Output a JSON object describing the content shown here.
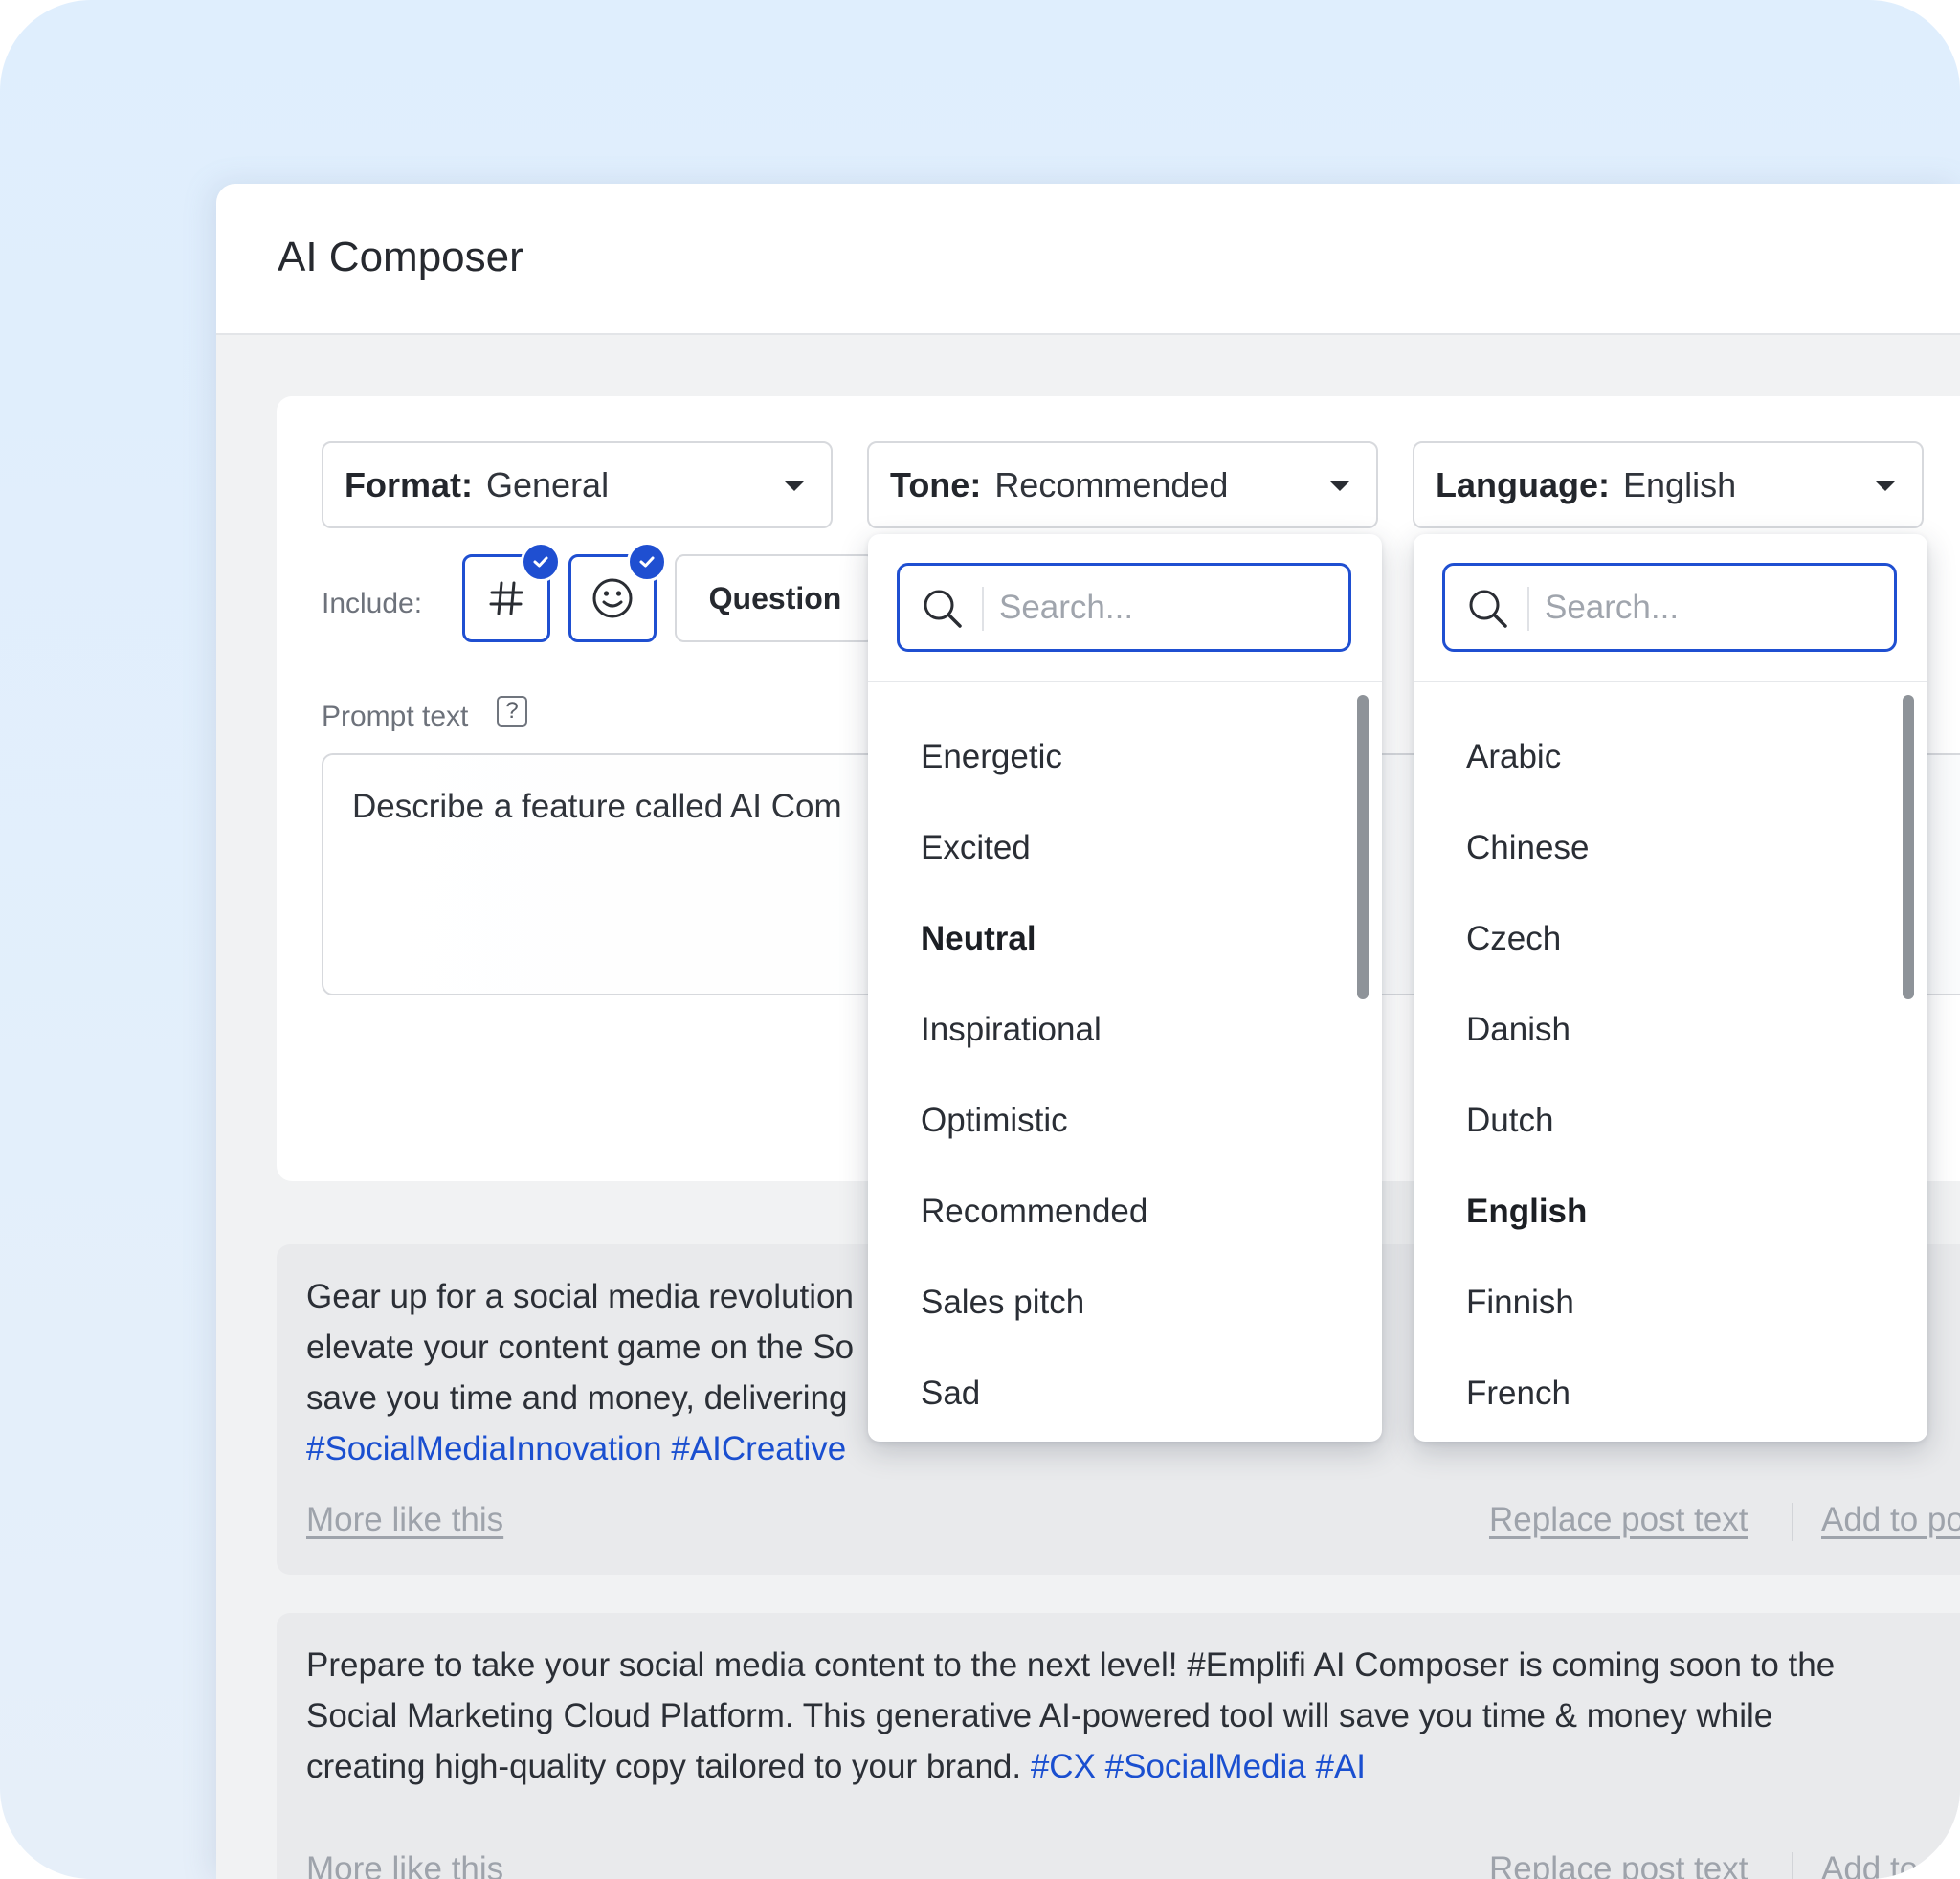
{
  "window": {
    "title": "AI Composer"
  },
  "controls": {
    "format": {
      "label": "Format:",
      "value": "General"
    },
    "tone": {
      "label": "Tone:",
      "value": "Recommended"
    },
    "language": {
      "label": "Language:",
      "value": "English"
    },
    "include_label": "Include:",
    "include_chips": [
      {
        "icon": "hashtag-icon",
        "checked": true
      },
      {
        "icon": "smiley-icon",
        "checked": true
      }
    ],
    "question_label": "Question",
    "prompt_label": "Prompt text",
    "help_glyph": "?",
    "prompt_value": "Describe a feature called AI Com"
  },
  "tone_dropdown": {
    "placeholder": "Search...",
    "items": [
      "Energetic",
      "Excited",
      "Neutral",
      "Inspirational",
      "Optimistic",
      "Recommended",
      "Sales pitch",
      "Sad"
    ],
    "selected": "Neutral"
  },
  "language_dropdown": {
    "placeholder": "Search...",
    "items": [
      "Arabic",
      "Chinese",
      "Czech",
      "Danish",
      "Dutch",
      "English",
      "Finnish",
      "French"
    ],
    "selected": "English"
  },
  "results": [
    {
      "lines": [
        "Gear up for a social media revolution",
        "elevate your content game on the So",
        "save you time and money, delivering"
      ],
      "hashtags": "#SocialMediaInnovation #AICreative",
      "more_label": "More like this",
      "replace_label": "Replace post text",
      "add_label": "Add to post"
    },
    {
      "lines": [
        "Prepare to take your social media content to the next level! #Emplifi AI Composer is coming soon to the",
        "Social Marketing Cloud Platform. This generative AI-powered tool will save you time & money while",
        "creating high-quality copy tailored to your brand. "
      ],
      "hashtags": "#CX #SocialMedia #AI",
      "more_label": "More like this",
      "replace_label": "Replace post text",
      "add_label": "Add to post"
    }
  ],
  "colors": {
    "accent": "#1f4fd1",
    "hashtag": "#1a4fd0"
  }
}
